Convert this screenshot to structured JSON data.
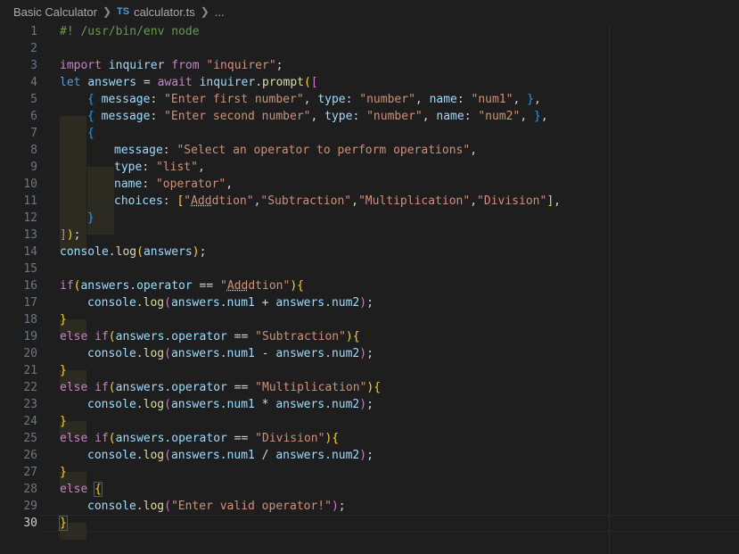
{
  "breadcrumb": {
    "folder": "Basic Calculator",
    "file_icon": "TS",
    "file": "calculator.ts",
    "more": "..."
  },
  "editor": {
    "active_line": 30,
    "line_numbers": [
      "1",
      "2",
      "3",
      "4",
      "5",
      "6",
      "7",
      "8",
      "9",
      "10",
      "11",
      "12",
      "13",
      "14",
      "15",
      "16",
      "17",
      "18",
      "19",
      "20",
      "21",
      "22",
      "23",
      "24",
      "25",
      "26",
      "27",
      "28",
      "29",
      "30"
    ],
    "tokens": {
      "l1": "#! /usr/bin/env node",
      "l3_import": "import",
      "l3_inquirer": "inquirer",
      "l3_from": "from",
      "l3_str": "\"inquirer\"",
      "l3_semi": ";",
      "l4_let": "let",
      "l4_answers": "answers",
      "l4_eq": " = ",
      "l4_await": "await",
      "l4_inquirer": "inquirer",
      "l4_dot": ".",
      "l4_prompt": "prompt",
      "l4_paren": "(",
      "l4_bracket": "[",
      "l5_ob": "{",
      "l5_message": "message",
      "l5_c1": ": ",
      "l5_s1": "\"Enter first number\"",
      "l5_c2": ", ",
      "l5_type": "type",
      "l5_c3": ": ",
      "l5_s2": "\"number\"",
      "l5_c4": ", ",
      "l5_name": "name",
      "l5_c5": ": ",
      "l5_s3": "\"num1\"",
      "l5_c6": ", ",
      "l5_cb": "}",
      "l5_c7": ",",
      "l6_ob": "{",
      "l6_message": "message",
      "l6_c1": ": ",
      "l6_s1": "\"Enter second number\"",
      "l6_c2": ", ",
      "l6_type": "type",
      "l6_c3": ": ",
      "l6_s2": "\"number\"",
      "l6_c4": ", ",
      "l6_name": "name",
      "l6_c5": ": ",
      "l6_s3": "\"num2\"",
      "l6_c6": ", ",
      "l6_cb": "}",
      "l6_c7": ",",
      "l7_ob": "{",
      "l8_message": "message",
      "l8_c": ": ",
      "l8_s": "\"Select an operator to perform operations\"",
      "l8_comma": ",",
      "l9_type": "type",
      "l9_c": ": ",
      "l9_s": "\"list\"",
      "l9_comma": ",",
      "l10_name": "name",
      "l10_c": ": ",
      "l10_s": "\"operator\"",
      "l10_comma": ",",
      "l11_choices": "choices",
      "l11_c": ": ",
      "l11_ob": "[",
      "l11_s1a": "\"",
      "l11_s1b": "Add",
      "l11_s1c": "dtion\"",
      "l11_comma1": ",",
      "l11_s2": "\"Subtraction\"",
      "l11_comma2": ",",
      "l11_s3": "\"Multiplication\"",
      "l11_comma3": ",",
      "l11_s4": "\"Division\"",
      "l11_cb": "]",
      "l11_comma4": ",",
      "l12_cb": "}",
      "l13_cb": "]",
      "l13_cp": ")",
      "l13_semi": ";",
      "console": "console",
      "dot": ".",
      "log": "log",
      "l14_op": "(",
      "l14_answers": "answers",
      "l14_cp": ")",
      "l14_semi": ";",
      "if": "if",
      "else": "else",
      "else_if": "else if",
      "answers_operator": "answers.operator",
      "eqeq": " == ",
      "s_addtion_a": "\"",
      "s_addtion_b": "Add",
      "s_addtion_c": "dtion\"",
      "s_sub": "\"Subtraction\"",
      "s_mul": "\"Multiplication\"",
      "s_div": "\"Division\"",
      "num1": "answers.num1",
      "num2": "answers.num2",
      "plus": " + ",
      "minus": " - ",
      "times": " * ",
      "divide": " / ",
      "l29_str": "\"Enter valid operator!\""
    }
  }
}
